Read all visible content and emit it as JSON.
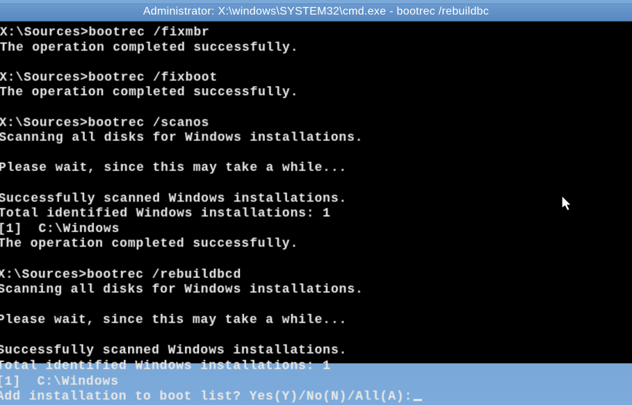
{
  "titlebar": "Administrator: X:\\windows\\SYSTEM32\\cmd.exe - bootrec  /rebuildbc",
  "lines": [
    {
      "type": "prompt",
      "prompt": "X:\\Sources>",
      "cmd": "bootrec /fixmbr"
    },
    {
      "type": "text",
      "text": "The operation completed successfully."
    },
    {
      "type": "blank"
    },
    {
      "type": "prompt",
      "prompt": "X:\\Sources>",
      "cmd": "bootrec /fixboot"
    },
    {
      "type": "text",
      "text": "The operation completed successfully."
    },
    {
      "type": "blank"
    },
    {
      "type": "prompt",
      "prompt": "X:\\Sources>",
      "cmd": "bootrec /scanos"
    },
    {
      "type": "text",
      "text": "Scanning all disks for Windows installations."
    },
    {
      "type": "blank"
    },
    {
      "type": "text",
      "text": "Please wait, since this may take a while..."
    },
    {
      "type": "blank"
    },
    {
      "type": "text",
      "text": "Successfully scanned Windows installations."
    },
    {
      "type": "text",
      "text": "Total identified Windows installations: 1"
    },
    {
      "type": "text",
      "text": "[1]  C:\\Windows"
    },
    {
      "type": "text",
      "text": "The operation completed successfully."
    },
    {
      "type": "blank"
    },
    {
      "type": "prompt",
      "prompt": "X:\\Sources>",
      "cmd": "bootrec /rebuildbcd"
    },
    {
      "type": "text",
      "text": "Scanning all disks for Windows installations."
    },
    {
      "type": "blank"
    },
    {
      "type": "text",
      "text": "Please wait, since this may take a while..."
    },
    {
      "type": "blank"
    },
    {
      "type": "text",
      "text": "Successfully scanned Windows installations."
    },
    {
      "type": "text",
      "text": "Total identified Windows installations: 1"
    },
    {
      "type": "text",
      "text": "[1]  C:\\Windows"
    },
    {
      "type": "input",
      "text": "Add installation to boot list? Yes(Y)/No(N)/All(A):"
    }
  ]
}
